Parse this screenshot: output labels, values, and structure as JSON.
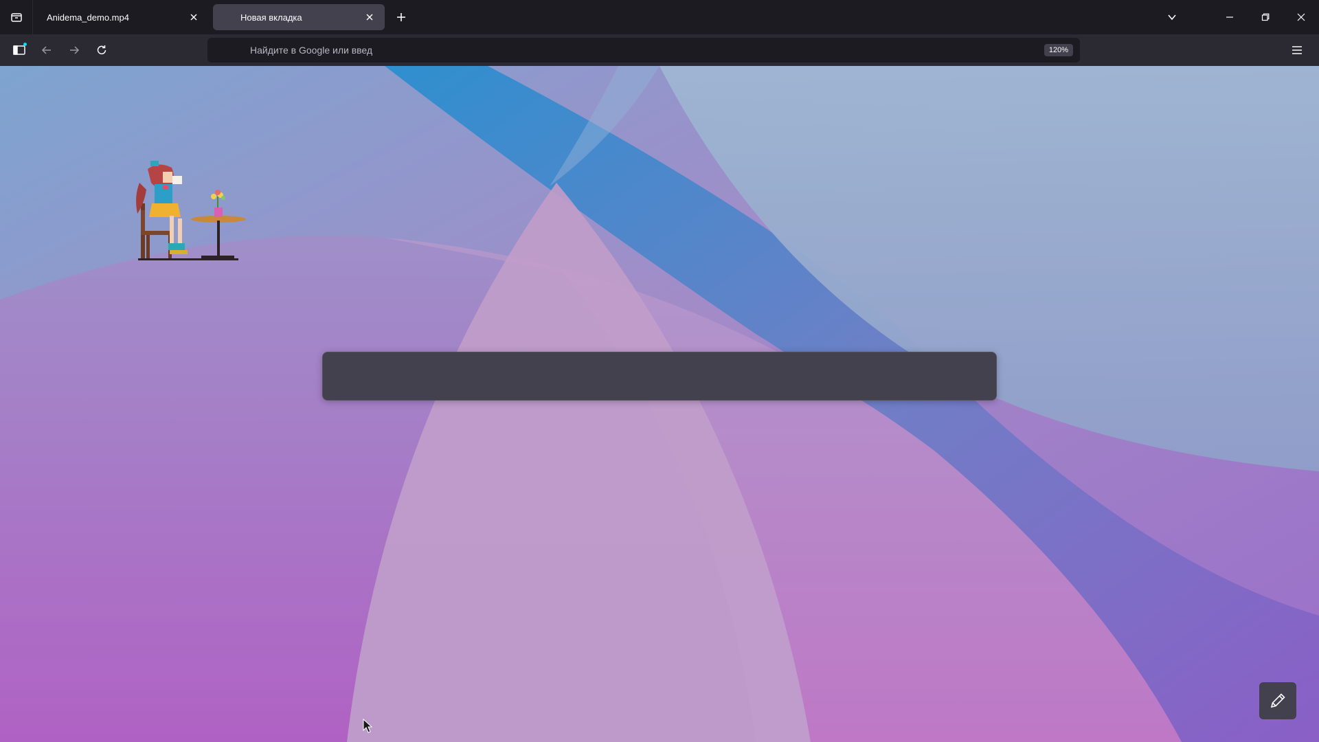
{
  "tabs": [
    {
      "title": "Anidema_demo.mp4",
      "active": false
    },
    {
      "title": "Новая вкладка",
      "active": true
    }
  ],
  "toolbar": {
    "url_placeholder": "Найдите в Google или введ",
    "zoom_level": "120%"
  },
  "newtab": {
    "search_placeholder": ""
  },
  "icons": {
    "tab_list": "tab-list-icon",
    "close": "close-icon",
    "new_tab": "plus-icon",
    "list_all_tabs": "chevron-down-icon",
    "minimize": "minimize-icon",
    "restore": "restore-icon",
    "sidebar": "sidebar-icon",
    "back": "arrow-left-icon",
    "forward": "arrow-right-icon",
    "reload": "reload-icon",
    "menu": "hamburger-menu-icon",
    "customize": "pencil-icon"
  },
  "colors": {
    "chrome_dark": "#1c1b22",
    "toolbar": "#2b2a33",
    "active_tab": "#42414d",
    "text": "#fbfbfe",
    "accent_dot": "#00ddff"
  }
}
